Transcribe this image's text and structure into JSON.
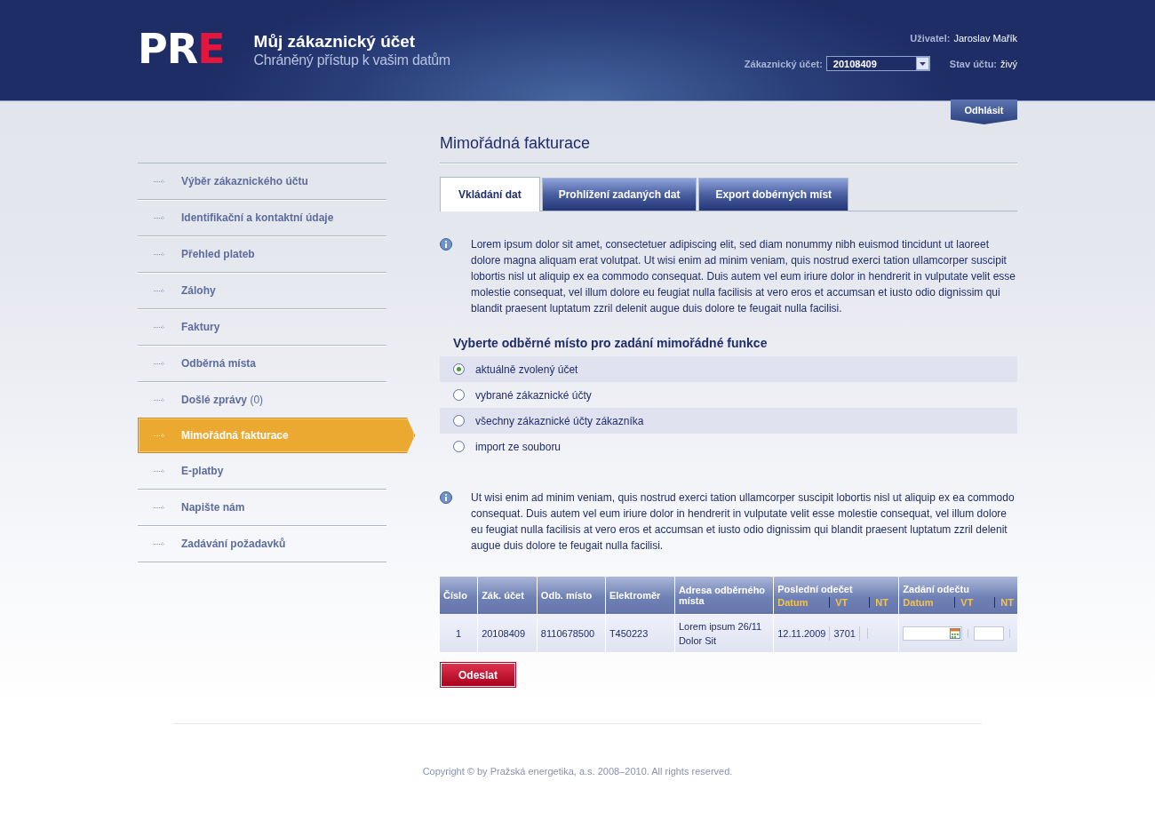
{
  "header": {
    "logo": [
      {
        "text": "PR",
        "color": "#ffffff"
      },
      {
        "text": "E",
        "color": "#e3173e"
      }
    ],
    "title": "Můj zákaznický účet",
    "subtitle": "Chráněný přístup k vašim datům",
    "user_label": "Uživatel:",
    "user_name": "Jaroslav Mařík",
    "account_label": "Zákaznický účet:",
    "account_value": "20108409",
    "status_label": "Stav účtu:",
    "status_value": "živý",
    "logout": "Odhlásit"
  },
  "sidebar": {
    "items": [
      {
        "label": "Výběr zákaznického účtu",
        "selected": false
      },
      {
        "label": "Identifikační a kontaktní údaje",
        "selected": false
      },
      {
        "label": "Přehled plateb",
        "selected": false
      },
      {
        "label": "Zálohy",
        "selected": false
      },
      {
        "label": "Faktury",
        "selected": false
      },
      {
        "label": "Odběrná místa",
        "selected": false
      },
      {
        "label": "Došlé zprávy",
        "count": "(0)",
        "selected": false
      },
      {
        "label": "Mimořádná fakturace",
        "selected": true
      },
      {
        "label": "E-platby",
        "selected": false
      },
      {
        "label": "Napište nám",
        "selected": false
      },
      {
        "label": "Zadávání požadavků",
        "selected": false
      }
    ]
  },
  "page_title": "Mimořádná fakturace",
  "tabs": [
    {
      "label": "Vkládání dat",
      "selected": true
    },
    {
      "label": "Prohlížení zadaných dat",
      "selected": false
    },
    {
      "label": "Export dobérných míst",
      "selected": false
    }
  ],
  "info_1": "Lorem ipsum dolor sit amet, consectetuer adipiscing elit, sed diam nonummy nibh euismod tincidunt ut laoreet dolore magna aliquam erat volutpat. Ut wisi enim ad minim veniam, quis nostrud exerci tation ullamcorper suscipit lobortis nisl ut aliquip ex ea commodo consequat. Duis autem vel eum iriure dolor in hendrerit in vulputate velit esse molestie consequat, vel illum dolore eu feugiat nulla facilisis at vero eros et accumsan et iusto odio dignissim qui blandit praesent luptatum zzril delenit augue duis dolore te feugait nulla facilisi.",
  "choice_heading": "Vyberte odběrné místo pro zadání mimořádné funkce",
  "choices": [
    {
      "label": "aktuálně zvolený účet",
      "selected": true
    },
    {
      "label": "vybrané zákaznické účty",
      "selected": false
    },
    {
      "label": "všechny zákaznické účty zákazníka",
      "selected": false
    },
    {
      "label": "import ze souboru",
      "selected": false
    }
  ],
  "info_2": "Ut wisi enim ad minim veniam, quis nostrud exerci tation ullamcorper suscipit lobortis nisl ut aliquip ex ea commodo consequat. Duis autem vel eum iriure dolor in hendrerit in vulputate velit esse molestie consequat, vel illum dolore eu feugiat nulla facilisis at vero eros et accumsan et iusto odio dignissim qui blandit praesent luptatum zzril delenit augue duis dolore te feugait nulla facilisi.",
  "table": {
    "columns": [
      {
        "label": "Číslo"
      },
      {
        "label": "Zák. účet"
      },
      {
        "label": "Odb. místo"
      },
      {
        "label": "Elektroměr"
      },
      {
        "label": "Adresa odběrného místa"
      },
      {
        "label": "Poslední odečet",
        "sub": [
          "Datum",
          "VT",
          "NT"
        ]
      },
      {
        "label": "Zadání odečtu",
        "sub": [
          "Datum",
          "VT",
          "NT"
        ]
      }
    ],
    "rows": [
      {
        "cells": [
          "1",
          "20108409",
          "8110678500",
          "T450223",
          "Lorem ipsum 26/11\nDolor Sit"
        ],
        "last_date": "12.11.2009",
        "last_vt": "3701"
      }
    ]
  },
  "submit": "Odeslat",
  "footer": "Copyright © by Pražská energetika, a.s. 2008–2010. All rights reserved."
}
